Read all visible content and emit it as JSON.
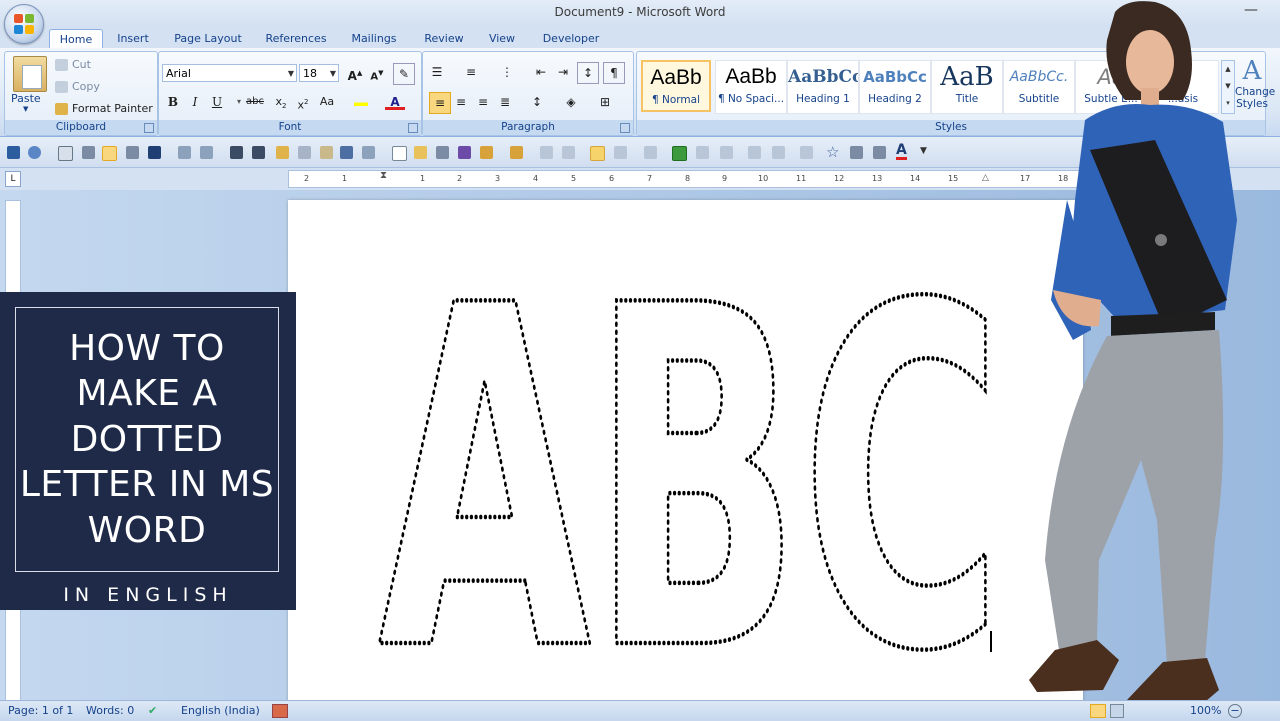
{
  "window": {
    "title": "Document9 - Microsoft Word"
  },
  "tabs": [
    "Home",
    "Insert",
    "Page Layout",
    "References",
    "Mailings",
    "Review",
    "View",
    "Developer"
  ],
  "clipboard": {
    "paste": "Paste",
    "cut": "Cut",
    "copy": "Copy",
    "format_painter": "Format Painter",
    "label": "Clipboard"
  },
  "font": {
    "name": "Arial",
    "size": "18",
    "label": "Font"
  },
  "paragraph": {
    "label": "Paragraph"
  },
  "styles": {
    "label": "Styles",
    "items": [
      {
        "sample": "AaBb",
        "name": "¶ Normal"
      },
      {
        "sample": "AaBb",
        "name": "¶ No Spaci..."
      },
      {
        "sample": "AaBbCc",
        "name": "Heading 1"
      },
      {
        "sample": "AaBbCc",
        "name": "Heading 2"
      },
      {
        "sample": "AaB",
        "name": "Title"
      },
      {
        "sample": "AaBbCc.",
        "name": "Subtitle"
      },
      {
        "sample": "Aa",
        "name": "Subtle E..."
      },
      {
        "sample": "b",
        "name": "...asis"
      }
    ],
    "change_styles": "Change Styles"
  },
  "ruler_ticks": [
    "2",
    "1",
    "1",
    "2",
    "3",
    "4",
    "5",
    "6",
    "7",
    "8",
    "9",
    "10",
    "11",
    "12",
    "13",
    "14",
    "15",
    "17",
    "18"
  ],
  "document": {
    "letters": "ABC"
  },
  "banner": {
    "title": "HOW TO MAKE A DOTTED LETTER IN MS WORD",
    "subtitle": "IN ENGLISH"
  },
  "status": {
    "page": "Page: 1 of 1",
    "words": "Words: 0",
    "language": "English (India)",
    "zoom": "100%"
  },
  "colors": {
    "banner_bg": "#1e2a47",
    "ribbon_text": "#15428b",
    "selected_style": "#f5c363"
  }
}
